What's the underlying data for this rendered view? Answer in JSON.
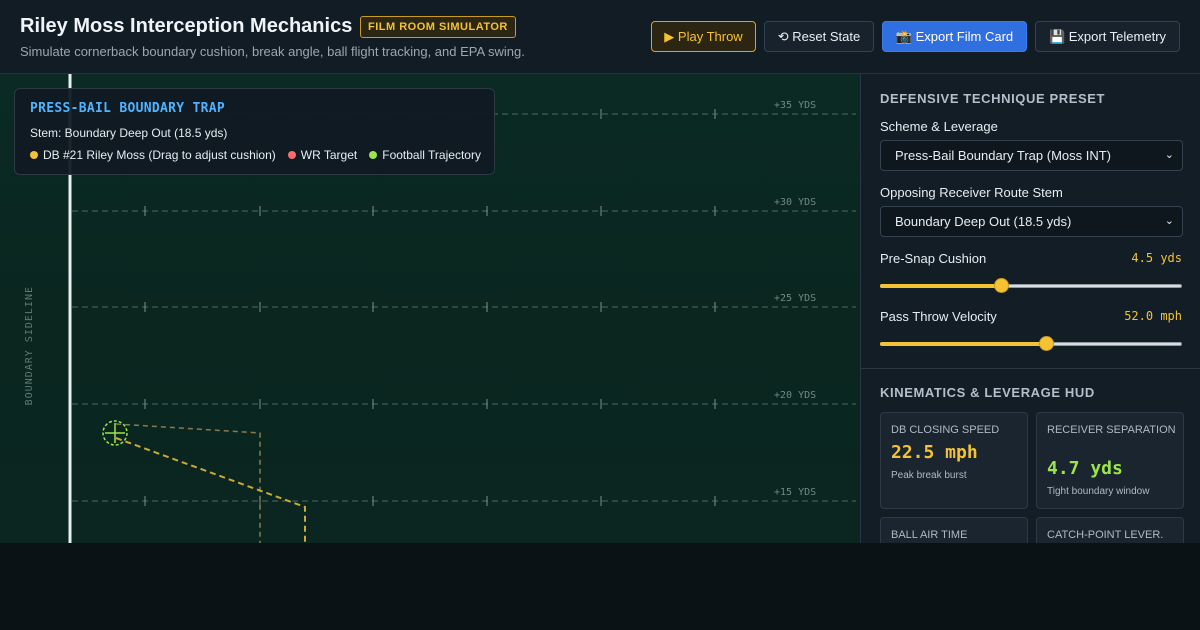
{
  "header": {
    "title": "Riley Moss Interception Mechanics",
    "badge": "FILM ROOM SIMULATOR",
    "subtitle": "Simulate cornerback boundary cushion, break angle, ball flight tracking, and EPA swing.",
    "buttons": {
      "play": "▶ Play Throw",
      "reset": "⟲ Reset State",
      "export_card": "📸 Export Film Card",
      "export_telemetry": "💾 Export Telemetry"
    }
  },
  "field": {
    "sideline_label": "BOUNDARY SIDELINE",
    "yard_labels": [
      "+35 YDS",
      "+30 YDS",
      "+25 YDS",
      "+20 YDS",
      "+15 YDS"
    ],
    "overlay": {
      "title": "PRESS-BAIL BOUNDARY TRAP",
      "stem": "Stem: Boundary Deep Out (18.5 yds)",
      "legend": [
        {
          "label": "DB #21 Riley Moss (Drag to adjust cushion)",
          "color": "#f4c232"
        },
        {
          "label": "WR Target",
          "color": "#ff6b6b"
        },
        {
          "label": "Football Trajectory",
          "color": "#9be54a"
        }
      ]
    },
    "colors": {
      "db_path": "#c9a93a",
      "wr_path": "#8a7a52",
      "football": "#9be54a"
    }
  },
  "panel": {
    "preset_title": "DEFENSIVE TECHNIQUE PRESET",
    "scheme_label": "Scheme & Leverage",
    "scheme_value": "Press-Bail Boundary Trap (Moss INT)",
    "stem_label": "Opposing Receiver Route Stem",
    "stem_value": "Boundary Deep Out (18.5 yds)",
    "cushion_label": "Pre-Snap Cushion",
    "cushion_value": "4.5 yds",
    "cushion_fraction": 0.4,
    "velocity_label": "Pass Throw Velocity",
    "velocity_value": "52.0 mph",
    "velocity_fraction": 0.55,
    "hud_title": "KINEMATICS & LEVERAGE HUD",
    "cards": [
      {
        "label": "DB CLOSING SPEED",
        "value": "22.5 mph",
        "note": "Peak break burst",
        "color": "#f4c232"
      },
      {
        "label": "RECEIVER SEPARATION",
        "value": "4.7 yds",
        "note": "Tight boundary window",
        "color": "#9be54a"
      },
      {
        "label": "BALL AIR TIME",
        "value": "",
        "note": "",
        "color": "#4fb3ff"
      },
      {
        "label": "CATCH-POINT LEVER.",
        "value": "",
        "note": "",
        "color": "#4fb3ff"
      }
    ]
  }
}
